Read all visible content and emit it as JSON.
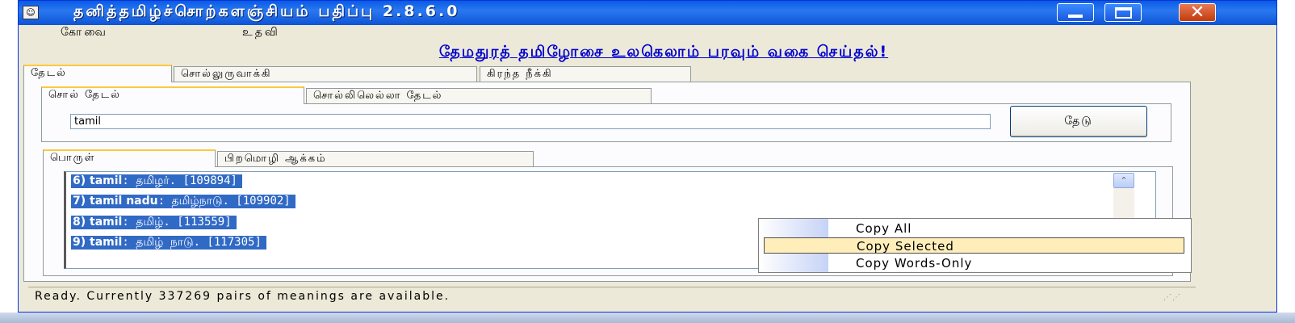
{
  "window": {
    "title": "தனித்தமிழ்ச்சொற்களஞ்சியம் பதிப்பு 2.8.6.0",
    "icon": "app-icon",
    "controls": {
      "minimize_icon": "minimize-icon",
      "maximize_icon": "maximize-icon",
      "close_icon": "close-icon",
      "close_glyph": "✕"
    }
  },
  "menu": {
    "items": [
      {
        "label": "கோவை"
      },
      {
        "label": "உதவி"
      }
    ]
  },
  "banner": "தேமதுரத் தமிழோசை உலகெலாம் பரவும் வகை செய்தல்!",
  "tabs_top": [
    {
      "label": "தேடல்"
    },
    {
      "label": "சொல்லுருவாக்கி"
    },
    {
      "label": "கிரந்த நீக்கி"
    }
  ],
  "tabs_search": [
    {
      "label": "சொல் தேடல்"
    },
    {
      "label": "சொல்லிலெல்லா தேடல்"
    }
  ],
  "search": {
    "value": "tamil",
    "button_label": "தேடு"
  },
  "tabs_result": [
    {
      "label": "பொருள்"
    },
    {
      "label": "பிறமொழி ஆக்கம்"
    }
  ],
  "results": [
    {
      "prefix": "6) tamil",
      "text": ": தமிழர். [109894]"
    },
    {
      "prefix": "7) tamil nadu",
      "text": ": தமிழ்நாடு. [109902]"
    },
    {
      "prefix": "8) tamil",
      "text": ": தமிழ். [113559]"
    },
    {
      "prefix": "9) tamil",
      "text": ": தமிழ் நாடு. [117305]"
    }
  ],
  "scrollbar": {
    "up_icon": "scroll-up-icon",
    "up_glyph": "⌃"
  },
  "context_menu": {
    "items": [
      {
        "label": "Copy All",
        "selected": false
      },
      {
        "label": "Copy Selected",
        "selected": true
      },
      {
        "label": "Copy Words-Only",
        "selected": false
      }
    ]
  },
  "status": "Ready. Currently 337269 pairs of meanings are available.",
  "colors": {
    "titlebar": "#0a5be6",
    "selection": "#316ac5",
    "menu_highlight": "#ffeeba",
    "banner_text": "#0000cc"
  }
}
